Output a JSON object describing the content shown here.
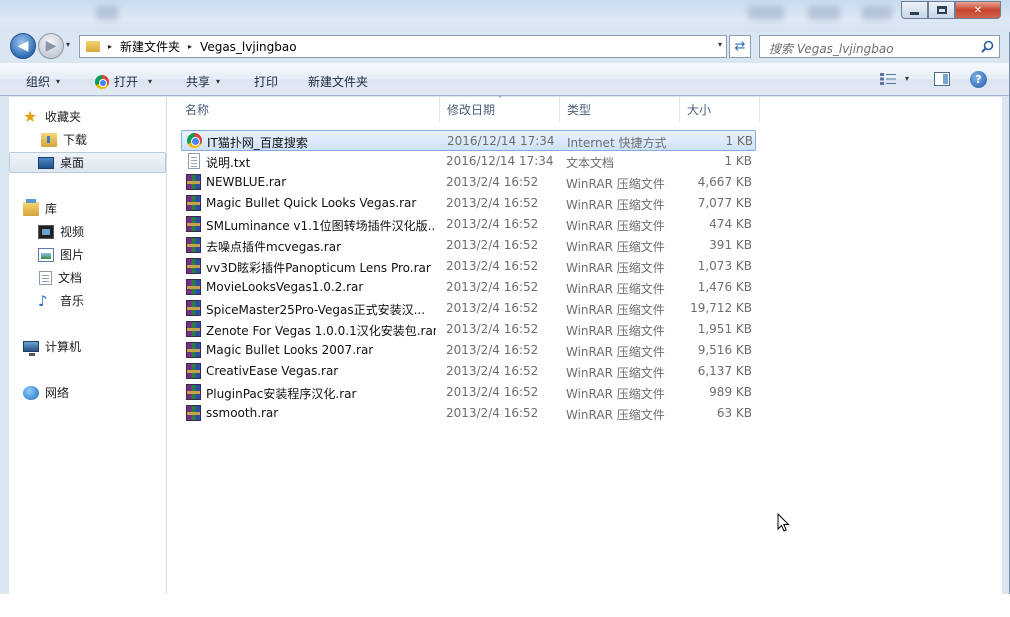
{
  "nav": {
    "back_glyph": "◀",
    "forward_glyph": "▶",
    "history_arrow": "▾"
  },
  "address": {
    "crumbs": [
      "新建文件夹",
      "Vegas_lvjingbao"
    ],
    "separator": "▸",
    "dropdown": "▾"
  },
  "refresh_glyph": "⇄",
  "search": {
    "placeholder": "搜索 Vegas_lvjingbao"
  },
  "toolbar": {
    "organize": "组织",
    "open": "打开",
    "share": "共享",
    "print": "打印",
    "new_folder": "新建文件夹",
    "arrow": "▾",
    "help": "?"
  },
  "sidebar": {
    "favorites": {
      "label": "收藏夹",
      "items": [
        {
          "label": "下载",
          "icon": "download-folder-icon"
        },
        {
          "label": "桌面",
          "icon": "desktop-icon",
          "selected": true
        }
      ]
    },
    "libraries": {
      "label": "库",
      "items": [
        {
          "label": "视频",
          "icon": "video-icon"
        },
        {
          "label": "图片",
          "icon": "picture-icon"
        },
        {
          "label": "文档",
          "icon": "document-icon"
        },
        {
          "label": "音乐",
          "icon": "music-icon"
        }
      ]
    },
    "computer": {
      "label": "计算机"
    },
    "network": {
      "label": "网络"
    }
  },
  "columns": {
    "name": "名称",
    "date": "修改日期",
    "type": "类型",
    "size": "大小"
  },
  "files": [
    {
      "name": "IT猫扑网_百度搜索",
      "date": "2016/12/14 17:34",
      "type": "Internet 快捷方式",
      "size": "1 KB",
      "icon": "url-shortcut-icon",
      "selected": true
    },
    {
      "name": "说明.txt",
      "date": "2016/12/14 17:34",
      "type": "文本文档",
      "size": "1 KB",
      "icon": "text-file-icon"
    },
    {
      "name": "NEWBLUE.rar",
      "date": "2013/2/4 16:52",
      "type": "WinRAR 压缩文件",
      "size": "4,667 KB",
      "icon": "rar-icon"
    },
    {
      "name": "Magic Bullet Quick Looks Vegas.rar",
      "date": "2013/2/4 16:52",
      "type": "WinRAR 压缩文件",
      "size": "7,077 KB",
      "icon": "rar-icon"
    },
    {
      "name": "SMLuminance v1.1位图转场插件汉化版...",
      "date": "2013/2/4 16:52",
      "type": "WinRAR 压缩文件",
      "size": "474 KB",
      "icon": "rar-icon"
    },
    {
      "name": "去噪点插件mcvegas.rar",
      "date": "2013/2/4 16:52",
      "type": "WinRAR 压缩文件",
      "size": "391 KB",
      "icon": "rar-icon"
    },
    {
      "name": "vv3D眩彩插件Panopticum Lens Pro.rar",
      "date": "2013/2/4 16:52",
      "type": "WinRAR 压缩文件",
      "size": "1,073 KB",
      "icon": "rar-icon"
    },
    {
      "name": "MovieLooksVegas1.0.2.rar",
      "date": "2013/2/4 16:52",
      "type": "WinRAR 压缩文件",
      "size": "1,476 KB",
      "icon": "rar-icon"
    },
    {
      "name": "SpiceMaster25Pro-Vegas正式安装汉...",
      "date": "2013/2/4 16:52",
      "type": "WinRAR 压缩文件",
      "size": "19,712 KB",
      "icon": "rar-icon"
    },
    {
      "name": "Zenote For Vegas 1.0.0.1汉化安装包.rar",
      "date": "2013/2/4 16:52",
      "type": "WinRAR 压缩文件",
      "size": "1,951 KB",
      "icon": "rar-icon"
    },
    {
      "name": "Magic Bullet Looks 2007.rar",
      "date": "2013/2/4 16:52",
      "type": "WinRAR 压缩文件",
      "size": "9,516 KB",
      "icon": "rar-icon"
    },
    {
      "name": "CreativEase Vegas.rar",
      "date": "2013/2/4 16:52",
      "type": "WinRAR 压缩文件",
      "size": "6,137 KB",
      "icon": "rar-icon"
    },
    {
      "name": "PluginPac安装程序汉化.rar",
      "date": "2013/2/4 16:52",
      "type": "WinRAR 压缩文件",
      "size": "989 KB",
      "icon": "rar-icon"
    },
    {
      "name": "ssmooth.rar",
      "date": "2013/2/4 16:52",
      "type": "WinRAR 压缩文件",
      "size": "63 KB",
      "icon": "rar-icon"
    }
  ],
  "colors": {
    "selection_border": "#84acdd",
    "selection_fill": "#cfe2f9",
    "frame": "#dbe6f3",
    "close_button": "#c7452e"
  }
}
